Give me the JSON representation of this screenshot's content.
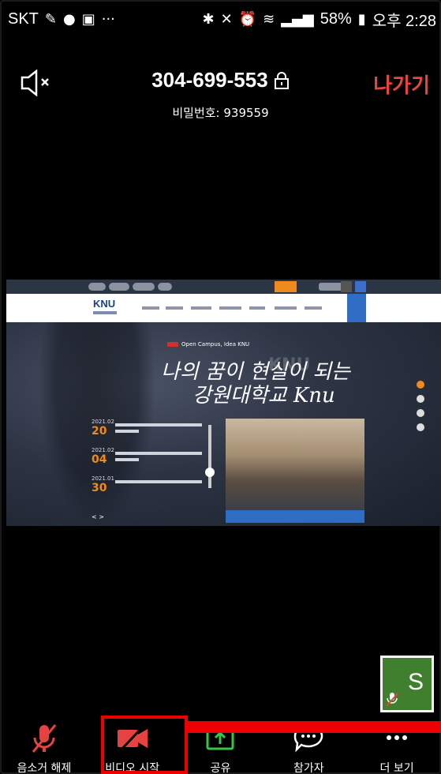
{
  "status_bar": {
    "carrier": "SKT",
    "battery": "58%",
    "time": "오후 2:28"
  },
  "meeting": {
    "id": "304-699-553",
    "password_label": "비밀번호: 939559",
    "leave_label": "나가기"
  },
  "shared_screen": {
    "logo": "KNU",
    "hero_tag": "Open Campus, Idea KNU",
    "hero_script_line1": "나의 꿈이 현실이 되는",
    "hero_script_line2": "강원대학교 Knu",
    "hero_watermark": "KNU",
    "news": [
      {
        "date_top": "2021.02",
        "day": "20"
      },
      {
        "date_top": "2021.02",
        "day": "04"
      },
      {
        "date_top": "2021.01",
        "day": "30"
      }
    ],
    "pager": "< >"
  },
  "self_view": {
    "initial": "S"
  },
  "toolbar": {
    "items": [
      {
        "label": "음소거 해제",
        "icon": "muted-mic-icon"
      },
      {
        "label": "비디오 시작",
        "icon": "video-off-icon"
      },
      {
        "label": "공유",
        "icon": "share-icon"
      },
      {
        "label": "참가자",
        "icon": "participants-icon"
      },
      {
        "label": "더 보기",
        "icon": "more-icon"
      }
    ]
  },
  "colors": {
    "leave": "#e8463c",
    "mute_red": "#e64340",
    "share_green": "#3cc24a",
    "highlight": "#ee0000"
  }
}
